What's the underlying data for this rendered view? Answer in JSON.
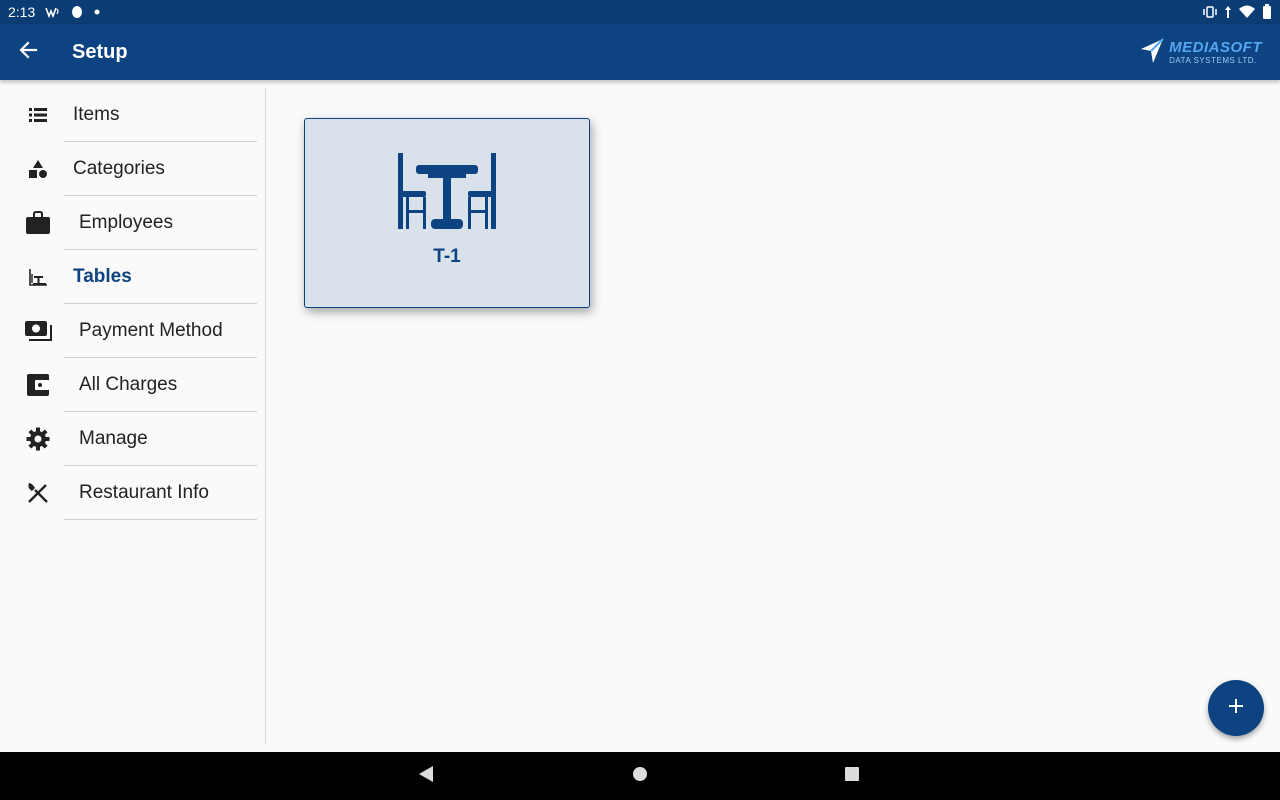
{
  "status_bar": {
    "time": "2:13",
    "left_icons": [
      "wifi-calling-icon",
      "notification-icon",
      "dot-icon"
    ],
    "right_icons": [
      "vibrate-icon",
      "data-icon",
      "wifi-icon",
      "battery-icon"
    ]
  },
  "app_bar": {
    "title": "Setup",
    "brand_name": "MEDIASOFT",
    "brand_sub": "DATA SYSTEMS LTD.",
    "brand_mark": "®"
  },
  "sidebar": {
    "items": [
      {
        "label": "Items",
        "icon": "list-icon"
      },
      {
        "label": "Categories",
        "icon": "shapes-icon"
      },
      {
        "label": "Employees",
        "icon": "briefcase-icon"
      },
      {
        "label": "Tables",
        "icon": "table-chairs-icon",
        "active": true
      },
      {
        "label": "Payment Method",
        "icon": "payments-icon"
      },
      {
        "label": "All Charges",
        "icon": "wallet-icon"
      },
      {
        "label": "Manage",
        "icon": "gear-icon"
      },
      {
        "label": "Restaurant Info",
        "icon": "utensils-icon"
      }
    ]
  },
  "tables": [
    {
      "label": "T-1"
    }
  ],
  "fab_label": "+",
  "colors": {
    "primary": "#0d4381",
    "status_bar": "#0b3c73",
    "card_bg": "#d9e1ea",
    "background": "#fafafa"
  }
}
